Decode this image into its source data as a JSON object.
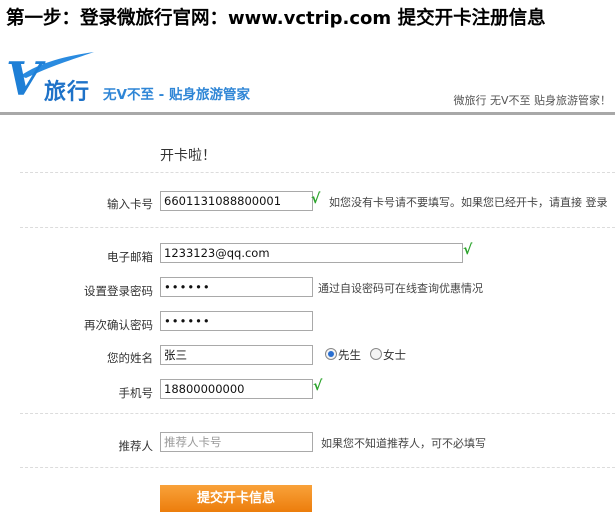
{
  "step_title": {
    "prefix": "第一步：登录微旅行官网：",
    "url": "www.vctrip.com",
    "suffix": " 提交开卡注册信息"
  },
  "header": {
    "logo_v": "V",
    "logo_name": "旅行",
    "slogan": "无V不至 - 贴身旅游管家",
    "right_text": "微旅行 无V不至 贴身旅游管家！",
    "accent_color": "#1e7fd6",
    "rule_color": "#a8a8a8"
  },
  "form": {
    "heading": "开卡啦！",
    "card": {
      "label": "输入卡号",
      "value": "6601131088800001",
      "check": "√",
      "hint": "如您没有卡号请不要填写。如果您已经开卡，请直接 登录"
    },
    "email": {
      "label": "电子邮箱",
      "value": "1233123@qq.com",
      "check": "√"
    },
    "password": {
      "label": "设置登录密码",
      "value": "••••••",
      "hint": "通过自设密码可在线查询优惠情况"
    },
    "confirm": {
      "label": "再次确认密码",
      "value": "••••••"
    },
    "name": {
      "label": "您的姓名",
      "value": "张三",
      "gender_options": [
        "先生",
        "女士"
      ],
      "gender_selected": "先生"
    },
    "phone": {
      "label": "手机号",
      "value": "18800000000",
      "check": "√"
    },
    "referrer": {
      "label": "推荐人",
      "placeholder": "推荐人卡号",
      "hint": "如果您不知道推荐人，可不必填写"
    },
    "submit_label": "提交开卡信息",
    "submit_color": "#ef8a1c"
  }
}
